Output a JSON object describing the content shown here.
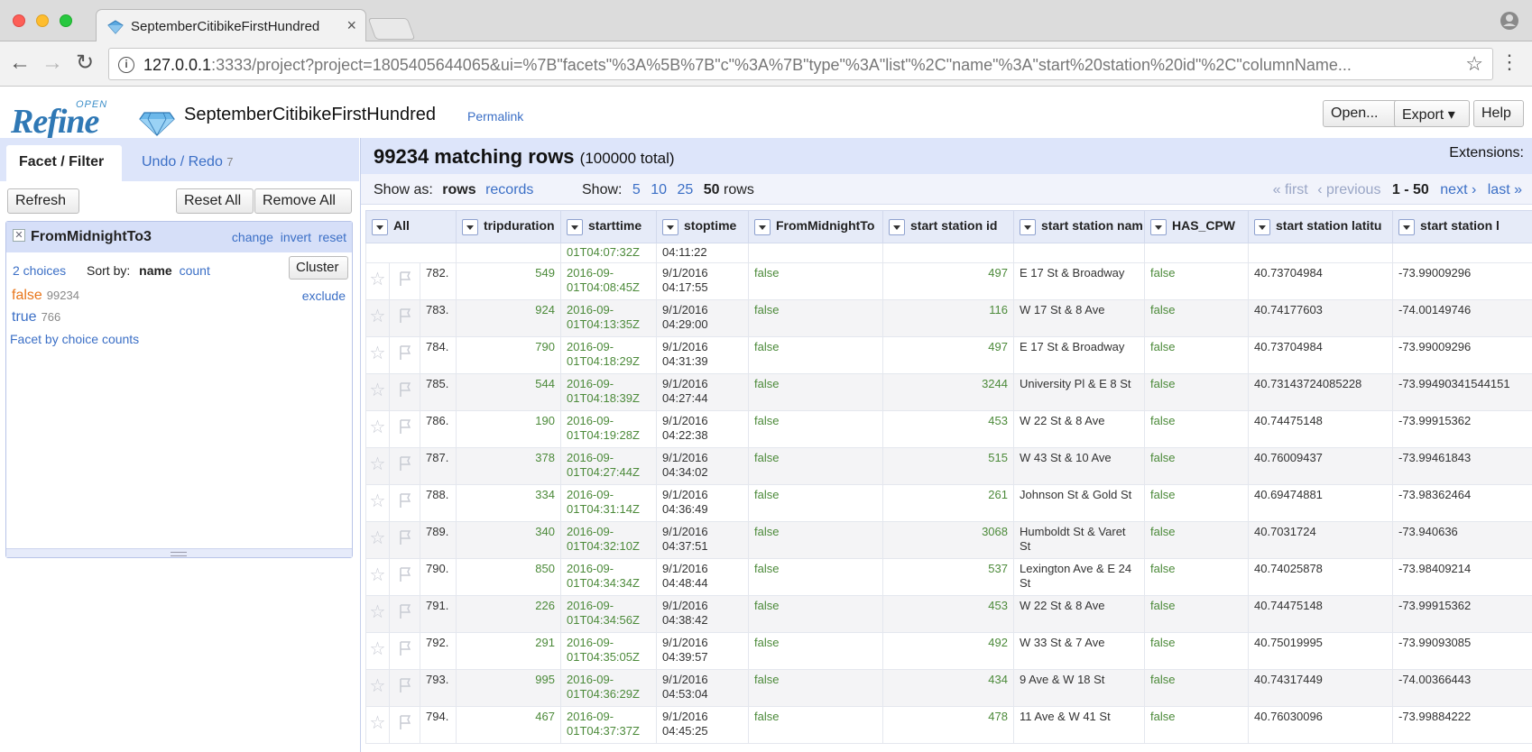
{
  "browser": {
    "tab_title": "SeptemberCitibikeFirstHundred",
    "url_host": "127.0.0.1",
    "url_rest": ":3333/project?project=1805405644065&ui=%7B\"facets\"%3A%5B%7B\"c\"%3A%7B\"type\"%3A\"list\"%2C\"name\"%3A\"start%20station%20id\"%2C\"columnName...",
    "info_glyph": "i"
  },
  "app": {
    "logo_open": "OPEN",
    "logo_refine": "Refine",
    "project_name": "SeptemberCitibikeFirstHundred",
    "permalink": "Permalink",
    "open_button": "Open...",
    "export_button": "Export ▾",
    "help_button": "Help"
  },
  "left": {
    "tab_facet": "Facet / Filter",
    "tab_undo": "Undo / Redo",
    "undo_count": "7",
    "refresh": "Refresh",
    "reset_all": "Reset All",
    "remove_all": "Remove All",
    "facet": {
      "title": "FromMidnightTo3",
      "change": "change",
      "invert": "invert",
      "reset": "reset",
      "choices_count": "2 choices",
      "sort_by": "Sort by:",
      "sort_name": "name",
      "sort_count": "count",
      "cluster": "Cluster",
      "choices": [
        {
          "label": "false",
          "count": "99234"
        },
        {
          "label": "true",
          "count": "766"
        }
      ],
      "exclude": "exclude",
      "facet_by_counts": "Facet by choice counts"
    }
  },
  "right": {
    "matching": "99234 matching rows",
    "total": "(100000 total)",
    "extensions": "Extensions:",
    "show_as_label": "Show as:",
    "show_as_rows": "rows",
    "show_as_records": "records",
    "show_label": "Show:",
    "page_sizes": [
      "5",
      "10",
      "25",
      "50"
    ],
    "rows_word": "rows",
    "pager_first": "« first",
    "pager_prev": "‹ previous",
    "pager_range": "1 - 50",
    "pager_next": "next ›",
    "pager_last": "last »"
  },
  "table": {
    "columns": [
      "All",
      "tripduration",
      "starttime",
      "stoptime",
      "FromMidnightTo",
      "start station id",
      "start station nam",
      "HAS_CPW",
      "start station latitu",
      "start station l"
    ],
    "partial_row": {
      "starttime": "01T04:07:32Z",
      "stoptime": "04:11:22"
    },
    "rows": [
      {
        "idx": "782.",
        "tripduration": "549",
        "start_a": "2016-09-",
        "start_b": "01T04:08:45Z",
        "stop_a": "9/1/2016",
        "stop_b": "04:17:55",
        "fm": "false",
        "sid": "497",
        "sname": "E 17 St & Broadway",
        "cpw": "false",
        "lat": "40.73704984",
        "lon": "-73.99009296"
      },
      {
        "idx": "783.",
        "tripduration": "924",
        "start_a": "2016-09-",
        "start_b": "01T04:13:35Z",
        "stop_a": "9/1/2016",
        "stop_b": "04:29:00",
        "fm": "false",
        "sid": "116",
        "sname": "W 17 St & 8 Ave",
        "cpw": "false",
        "lat": "40.74177603",
        "lon": "-74.00149746"
      },
      {
        "idx": "784.",
        "tripduration": "790",
        "start_a": "2016-09-",
        "start_b": "01T04:18:29Z",
        "stop_a": "9/1/2016",
        "stop_b": "04:31:39",
        "fm": "false",
        "sid": "497",
        "sname": "E 17 St & Broadway",
        "cpw": "false",
        "lat": "40.73704984",
        "lon": "-73.99009296"
      },
      {
        "idx": "785.",
        "tripduration": "544",
        "start_a": "2016-09-",
        "start_b": "01T04:18:39Z",
        "stop_a": "9/1/2016",
        "stop_b": "04:27:44",
        "fm": "false",
        "sid": "3244",
        "sname": "University Pl & E 8 St",
        "cpw": "false",
        "lat": "40.73143724085228",
        "lon": "-73.99490341544151"
      },
      {
        "idx": "786.",
        "tripduration": "190",
        "start_a": "2016-09-",
        "start_b": "01T04:19:28Z",
        "stop_a": "9/1/2016",
        "stop_b": "04:22:38",
        "fm": "false",
        "sid": "453",
        "sname": "W 22 St & 8 Ave",
        "cpw": "false",
        "lat": "40.74475148",
        "lon": "-73.99915362"
      },
      {
        "idx": "787.",
        "tripduration": "378",
        "start_a": "2016-09-",
        "start_b": "01T04:27:44Z",
        "stop_a": "9/1/2016",
        "stop_b": "04:34:02",
        "fm": "false",
        "sid": "515",
        "sname": "W 43 St & 10 Ave",
        "cpw": "false",
        "lat": "40.76009437",
        "lon": "-73.99461843"
      },
      {
        "idx": "788.",
        "tripduration": "334",
        "start_a": "2016-09-",
        "start_b": "01T04:31:14Z",
        "stop_a": "9/1/2016",
        "stop_b": "04:36:49",
        "fm": "false",
        "sid": "261",
        "sname": "Johnson St & Gold St",
        "cpw": "false",
        "lat": "40.69474881",
        "lon": "-73.98362464"
      },
      {
        "idx": "789.",
        "tripduration": "340",
        "start_a": "2016-09-",
        "start_b": "01T04:32:10Z",
        "stop_a": "9/1/2016",
        "stop_b": "04:37:51",
        "fm": "false",
        "sid": "3068",
        "sname": "Humboldt St & Varet St",
        "cpw": "false",
        "lat": "40.7031724",
        "lon": "-73.940636"
      },
      {
        "idx": "790.",
        "tripduration": "850",
        "start_a": "2016-09-",
        "start_b": "01T04:34:34Z",
        "stop_a": "9/1/2016",
        "stop_b": "04:48:44",
        "fm": "false",
        "sid": "537",
        "sname": "Lexington Ave & E 24 St",
        "cpw": "false",
        "lat": "40.74025878",
        "lon": "-73.98409214"
      },
      {
        "idx": "791.",
        "tripduration": "226",
        "start_a": "2016-09-",
        "start_b": "01T04:34:56Z",
        "stop_a": "9/1/2016",
        "stop_b": "04:38:42",
        "fm": "false",
        "sid": "453",
        "sname": "W 22 St & 8 Ave",
        "cpw": "false",
        "lat": "40.74475148",
        "lon": "-73.99915362"
      },
      {
        "idx": "792.",
        "tripduration": "291",
        "start_a": "2016-09-",
        "start_b": "01T04:35:05Z",
        "stop_a": "9/1/2016",
        "stop_b": "04:39:57",
        "fm": "false",
        "sid": "492",
        "sname": "W 33 St & 7 Ave",
        "cpw": "false",
        "lat": "40.75019995",
        "lon": "-73.99093085"
      },
      {
        "idx": "793.",
        "tripduration": "995",
        "start_a": "2016-09-",
        "start_b": "01T04:36:29Z",
        "stop_a": "9/1/2016",
        "stop_b": "04:53:04",
        "fm": "false",
        "sid": "434",
        "sname": "9 Ave & W 18 St",
        "cpw": "false",
        "lat": "40.74317449",
        "lon": "-74.00366443"
      },
      {
        "idx": "794.",
        "tripduration": "467",
        "start_a": "2016-09-",
        "start_b": "01T04:37:37Z",
        "stop_a": "9/1/2016",
        "stop_b": "04:45:25",
        "fm": "false",
        "sid": "478",
        "sname": "11 Ave & W 41 St",
        "cpw": "false",
        "lat": "40.76030096",
        "lon": "-73.99884222"
      }
    ]
  }
}
